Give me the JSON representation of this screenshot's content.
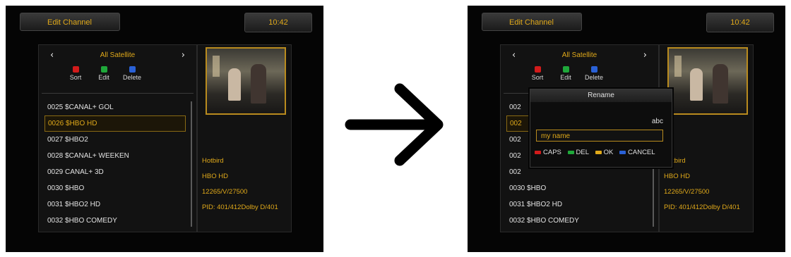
{
  "left": {
    "header_title": "Edit Channel",
    "clock": "10:42",
    "satellite": "All Satellite",
    "nav_prev": "‹",
    "nav_next": "›",
    "buttons": {
      "sort": "Sort",
      "edit": "Edit",
      "delete": "Delete"
    },
    "channels": [
      {
        "label": "0025 $CANAL+ GOL"
      },
      {
        "label": "0026 $HBO HD",
        "selected": true
      },
      {
        "label": "0027 $HBO2"
      },
      {
        "label": "0028 $CANAL+ WEEKEN"
      },
      {
        "label": "0029 CANAL+ 3D"
      },
      {
        "label": "0030 $HBO"
      },
      {
        "label": "0031 $HBO2 HD"
      },
      {
        "label": "0032 $HBO COMEDY"
      }
    ],
    "info": {
      "satellite_name": "Hotbird",
      "channel_name": "HBO HD",
      "transponder": "12265/V/27500",
      "pid": "PID: 401/412Dolby D/401"
    }
  },
  "right": {
    "header_title": "Edit Channel",
    "clock": "10:42",
    "satellite": "All Satellite",
    "nav_prev": "‹",
    "nav_next": "›",
    "buttons": {
      "sort": "Sort",
      "edit": "Edit",
      "delete": "Delete"
    },
    "channels": [
      {
        "label": "002"
      },
      {
        "label": "002",
        "selected": true
      },
      {
        "label": "002"
      },
      {
        "label": "002"
      },
      {
        "label": "002"
      },
      {
        "label": "0030 $HBO"
      },
      {
        "label": "0031 $HBO2 HD"
      },
      {
        "label": "0032 $HBO COMEDY"
      }
    ],
    "info": {
      "satellite_name": "Hotbird",
      "channel_name": "HBO HD",
      "transponder": "12265/V/27500",
      "pid": "PID: 401/412Dolby D/401"
    },
    "rename_dialog": {
      "title": "Rename",
      "input_mode": "abc",
      "input_value": "my name",
      "keys": {
        "caps": "CAPS",
        "del": "DEL",
        "ok": "OK",
        "cancel": "CANCEL"
      }
    }
  },
  "colors": {
    "accent": "#e0a91a",
    "red": "#d21b1b",
    "green": "#1fa83a",
    "blue": "#2a61d6",
    "yellow": "#e0a91a"
  },
  "icons": {
    "transition": "arrow-right-icon"
  }
}
